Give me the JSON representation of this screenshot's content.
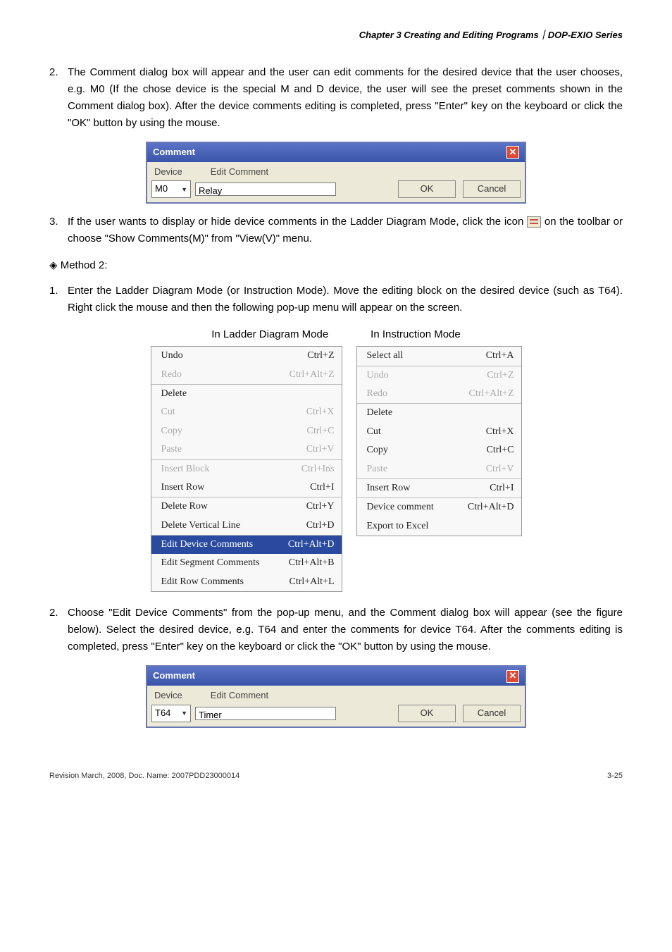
{
  "header": {
    "text": "Chapter 3 Creating and Editing Programs｜DOP-EXIO Series"
  },
  "p2": {
    "num": "2.",
    "text": "The Comment dialog box will appear and the user can edit comments for the desired device that the user chooses, e.g. M0 (If the chose device is the special M and D device, the user will see the preset comments shown in the Comment dialog box). After the device comments editing is completed, press \"Enter\" key on the keyboard or click the \"OK\" button by using the mouse."
  },
  "dialog1": {
    "title": "Comment",
    "h_device": "Device",
    "h_edit": "Edit Comment",
    "device_val": "M0",
    "edit_val": "Relay",
    "ok": "OK",
    "cancel": "Cancel"
  },
  "p3": {
    "num": "3.",
    "text_a": "If the user wants to display or hide device comments in the Ladder Diagram Mode, click the icon ",
    "text_b": " on the toolbar or choose \"Show Comments(M)\" from \"View(V)\" menu."
  },
  "method2": "◈ Method 2:",
  "p1m2": {
    "num": "1.",
    "text": "Enter the Ladder Diagram Mode (or Instruction Mode). Move the editing block on the desired device (such as T64). Right click the mouse and then the following pop-up menu will appear on the screen."
  },
  "modes": {
    "ladder": "In Ladder Diagram Mode",
    "instr": "In Instruction Mode"
  },
  "menuL": {
    "items": [
      {
        "l": "Undo",
        "r": "Ctrl+Z",
        "cls": ""
      },
      {
        "l": "Redo",
        "r": "Ctrl+Alt+Z",
        "cls": "disabled"
      }
    ],
    "items2": [
      {
        "l": "Delete",
        "r": "",
        "cls": ""
      },
      {
        "l": "Cut",
        "r": "Ctrl+X",
        "cls": "disabled"
      },
      {
        "l": "Copy",
        "r": "Ctrl+C",
        "cls": "disabled"
      },
      {
        "l": "Paste",
        "r": "Ctrl+V",
        "cls": "disabled"
      }
    ],
    "items3": [
      {
        "l": "Insert Block",
        "r": "Ctrl+Ins",
        "cls": "disabled"
      },
      {
        "l": "Insert Row",
        "r": "Ctrl+I",
        "cls": ""
      }
    ],
    "items4": [
      {
        "l": "Delete Row",
        "r": "Ctrl+Y",
        "cls": ""
      },
      {
        "l": "Delete Vertical Line",
        "r": "Ctrl+D",
        "cls": ""
      }
    ],
    "items5": [
      {
        "l": "Edit Device Comments",
        "r": "Ctrl+Alt+D",
        "cls": "highlight"
      },
      {
        "l": "Edit Segment Comments",
        "r": "Ctrl+Alt+B",
        "cls": ""
      },
      {
        "l": "Edit Row Comments",
        "r": "Ctrl+Alt+L",
        "cls": ""
      }
    ]
  },
  "menuR": {
    "items": [
      {
        "l": "Select all",
        "r": "Ctrl+A",
        "cls": ""
      }
    ],
    "items2": [
      {
        "l": "Undo",
        "r": "Ctrl+Z",
        "cls": "disabled"
      },
      {
        "l": "Redo",
        "r": "Ctrl+Alt+Z",
        "cls": "disabled"
      }
    ],
    "items3": [
      {
        "l": "Delete",
        "r": "",
        "cls": ""
      },
      {
        "l": "Cut",
        "r": "Ctrl+X",
        "cls": ""
      },
      {
        "l": "Copy",
        "r": "Ctrl+C",
        "cls": ""
      },
      {
        "l": "Paste",
        "r": "Ctrl+V",
        "cls": "disabled"
      }
    ],
    "items4": [
      {
        "l": "Insert  Row",
        "r": "Ctrl+I",
        "cls": ""
      }
    ],
    "items5": [
      {
        "l": "Device comment",
        "r": "Ctrl+Alt+D",
        "cls": ""
      },
      {
        "l": "Export to Excel",
        "r": "",
        "cls": ""
      }
    ]
  },
  "p2m2": {
    "num": "2.",
    "text": "Choose \"Edit Device Comments\" from the pop-up menu, and the Comment dialog box will appear (see the figure below). Select the desired device, e.g. T64 and enter the comments for device T64. After the comments editing is completed, press \"Enter\" key on the keyboard or click the \"OK\" button by using the mouse."
  },
  "dialog2": {
    "title": "Comment",
    "h_device": "Device",
    "h_edit": "Edit Comment",
    "device_val": "T64",
    "edit_val": "Timer",
    "ok": "OK",
    "cancel": "Cancel"
  },
  "footer": {
    "left": "Revision March, 2008, Doc. Name: 2007PDD23000014",
    "right": "3-25"
  }
}
